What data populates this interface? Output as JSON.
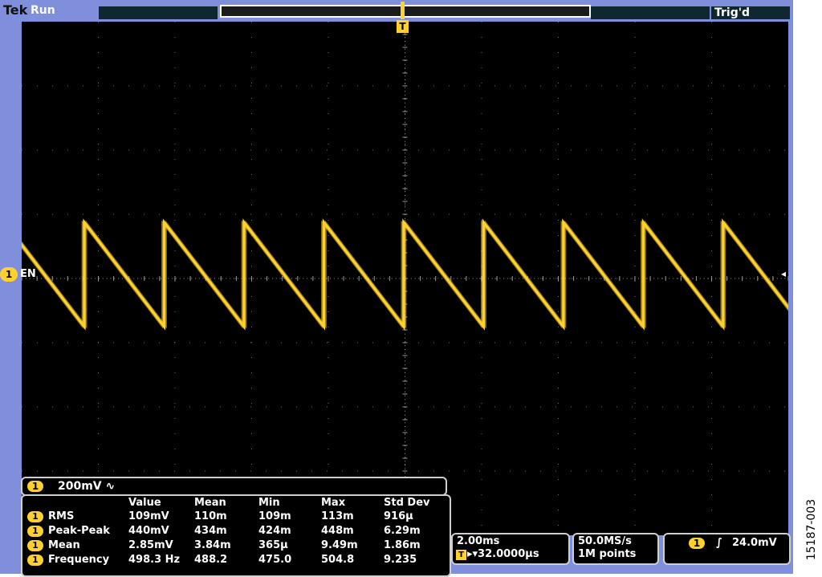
{
  "header": {
    "brand": "Tek",
    "acq_state": "Run",
    "trigger_status": "Trig'd",
    "trigger_marker": "T"
  },
  "channel": {
    "marker": "1",
    "label": "EN",
    "scale": "200mV ∿",
    "color": "#ffd12f"
  },
  "measurements": {
    "headers": [
      "Value",
      "Mean",
      "Min",
      "Max",
      "Std Dev"
    ],
    "rows": [
      {
        "ch": "1",
        "name": "RMS",
        "values": [
          "109mV",
          "110m",
          "109m",
          "113m",
          "916µ"
        ]
      },
      {
        "ch": "1",
        "name": "Peak-Peak",
        "values": [
          "440mV",
          "434m",
          "424m",
          "448m",
          "6.29m"
        ]
      },
      {
        "ch": "1",
        "name": "Mean",
        "values": [
          "2.85mV",
          "3.84m",
          "365µ",
          "9.49m",
          "1.86m"
        ]
      },
      {
        "ch": "1",
        "name": "Frequency",
        "values": [
          "498.3 Hz",
          "488.2",
          "475.0",
          "504.8",
          "9.235"
        ]
      }
    ]
  },
  "timebase": {
    "scale": "2.00ms",
    "position_marker": "T",
    "position": "▸▾32.0000µs"
  },
  "acquisition": {
    "sample_rate": "50.0MS/s",
    "record_length": "1M points"
  },
  "trigger": {
    "channel": "1",
    "slope": "∫",
    "level": "24.0mV"
  },
  "figure_id": "15187-003",
  "waveform": {
    "type": "sawtooth",
    "color": "#ffd12f",
    "cycles_on_screen": 9.6
  }
}
